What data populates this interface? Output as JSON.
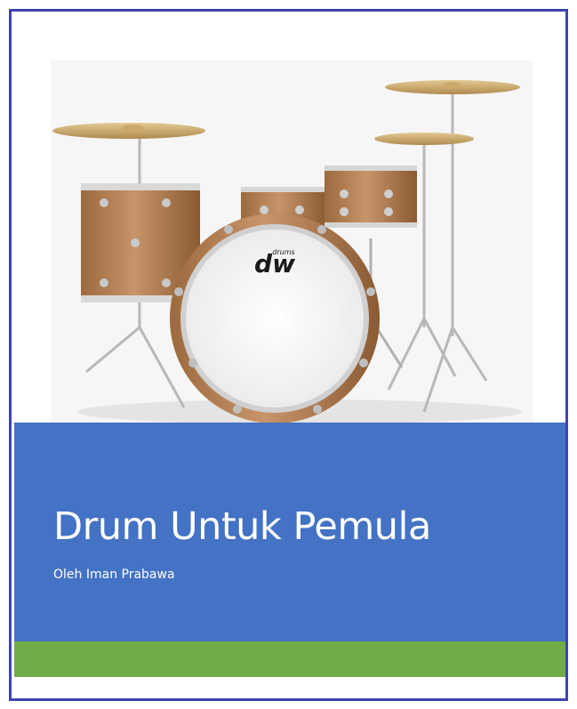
{
  "cover": {
    "title": "Drum Untuk Pemula",
    "author": "Oleh Iman Prabawa",
    "image": {
      "logo_text": "dw",
      "logo_subtext": "drums"
    }
  },
  "colors": {
    "frame": "#3f44b0",
    "title_band": "#4472c4",
    "accent_band": "#70ad47",
    "text": "#ffffff"
  }
}
